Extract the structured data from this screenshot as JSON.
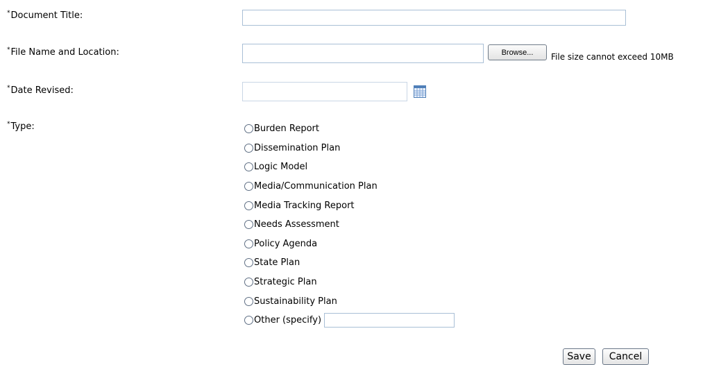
{
  "form": {
    "required_marker": "*",
    "document_title": {
      "label": "Document Title:",
      "value": ""
    },
    "file": {
      "label": "File Name and Location:",
      "value": "",
      "browse_label": "Browse...",
      "hint": "File size cannot exceed 10MB"
    },
    "date_revised": {
      "label": "Date Revised:",
      "value": "",
      "icon": "calendar-icon"
    },
    "type": {
      "label": "Type:",
      "options": [
        "Burden Report",
        "Dissemination Plan",
        "Logic Model",
        "Media/Communication Plan",
        "Media Tracking Report",
        "Needs Assessment",
        "Policy Agenda",
        "State Plan",
        "Strategic Plan",
        "Sustainability Plan",
        "Other (specify)"
      ],
      "other_value": ""
    }
  },
  "actions": {
    "save_label": "Save",
    "cancel_label": "Cancel"
  },
  "colors": {
    "input_border": "#a9bfd6",
    "button_border": "#6a7788",
    "radio_border": "#5f6f84"
  }
}
